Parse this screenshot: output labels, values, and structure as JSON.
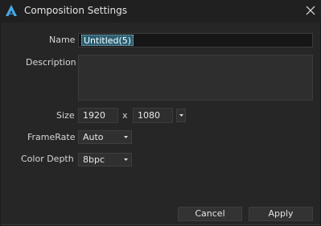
{
  "window": {
    "title": "Composition Settings"
  },
  "name": {
    "label": "Name",
    "value": "Untitled(5)"
  },
  "description": {
    "label": "Description",
    "value": ""
  },
  "size": {
    "label": "Size",
    "width": "1920",
    "separator": "x",
    "height": "1080"
  },
  "framerate": {
    "label": "FrameRate",
    "value": "Auto"
  },
  "color_depth": {
    "label": "Color Depth",
    "value": "8bpc"
  },
  "buttons": {
    "cancel": "Cancel",
    "apply": "Apply"
  },
  "colors": {
    "accent": "#2a5f73",
    "logo": "#48a9e6",
    "background": "#262626"
  },
  "icons": {
    "app": "app-logo-icon",
    "close": "close-icon",
    "dropdown": "caret-down-icon"
  }
}
